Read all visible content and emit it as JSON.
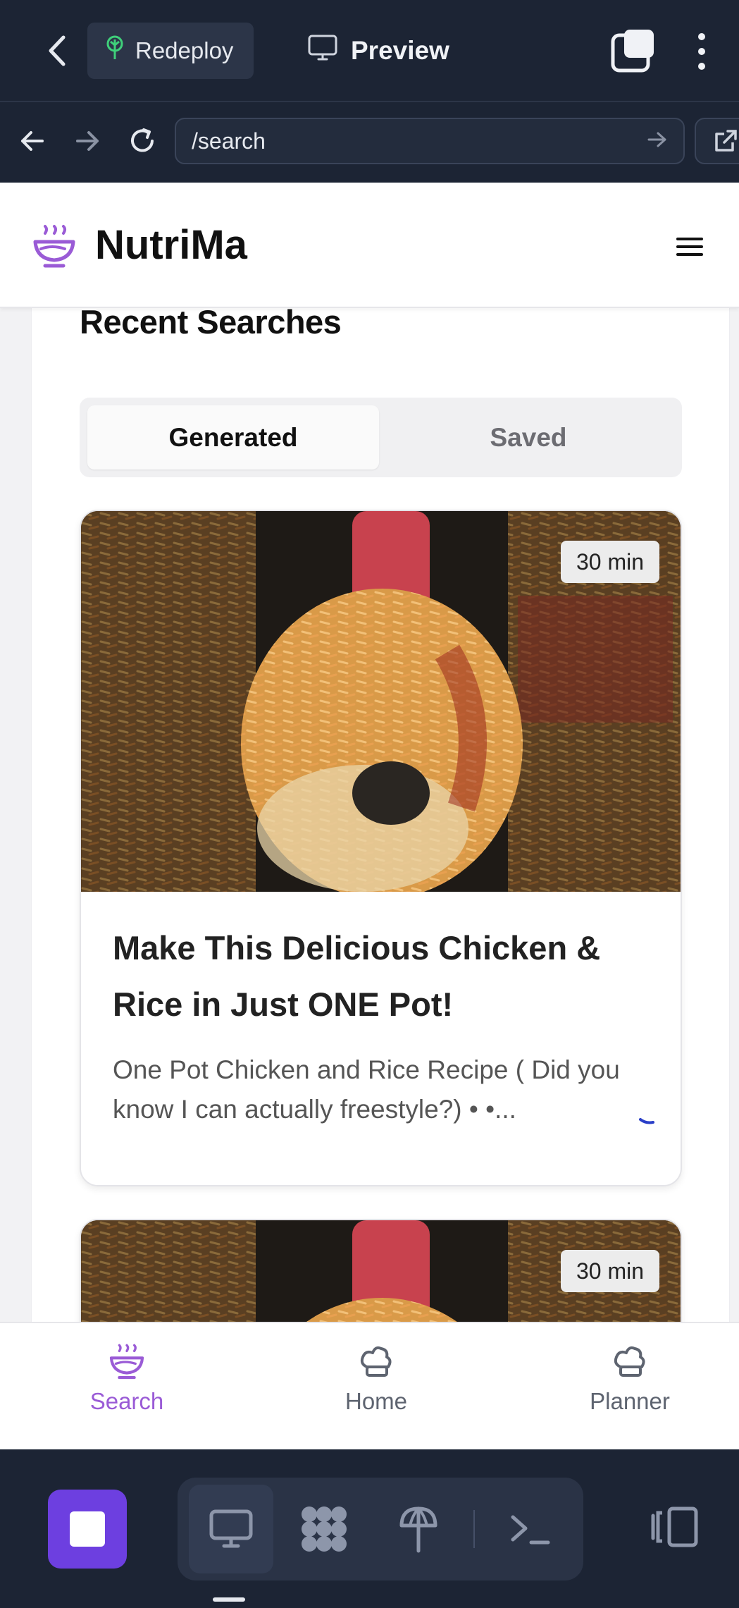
{
  "topbar": {
    "redeploy_label": "Redeploy",
    "preview_label": "Preview"
  },
  "urlbar": {
    "url": "/search"
  },
  "site": {
    "brand": "NutriMa",
    "accent_color": "#9a5bd6"
  },
  "main": {
    "section_title": "Recent Searches",
    "tabs": [
      {
        "label": "Generated",
        "active": true
      },
      {
        "label": "Saved",
        "active": false
      }
    ],
    "cards": [
      {
        "time": "30 min",
        "title": "Make This Delicious Chicken & Rice in Just ONE Pot!",
        "description": "One Pot Chicken and Rice Recipe ( Did you know I can actually freestyle?) • •..."
      },
      {
        "time": "30 min"
      }
    ]
  },
  "bottom_nav": {
    "items": [
      {
        "label": "Search",
        "icon": "bowl-icon",
        "active": true
      },
      {
        "label": "Home",
        "icon": "chef-hat-icon",
        "active": false
      },
      {
        "label": "Planner",
        "icon": "chef-hat-icon",
        "active": false
      }
    ]
  },
  "ide_toolbar": {
    "icons": [
      "stop-icon",
      "desktop-icon",
      "apps-icon",
      "deploy-icon",
      "terminal-icon",
      "panel-icon"
    ],
    "stop_color": "#6d3fe0"
  }
}
